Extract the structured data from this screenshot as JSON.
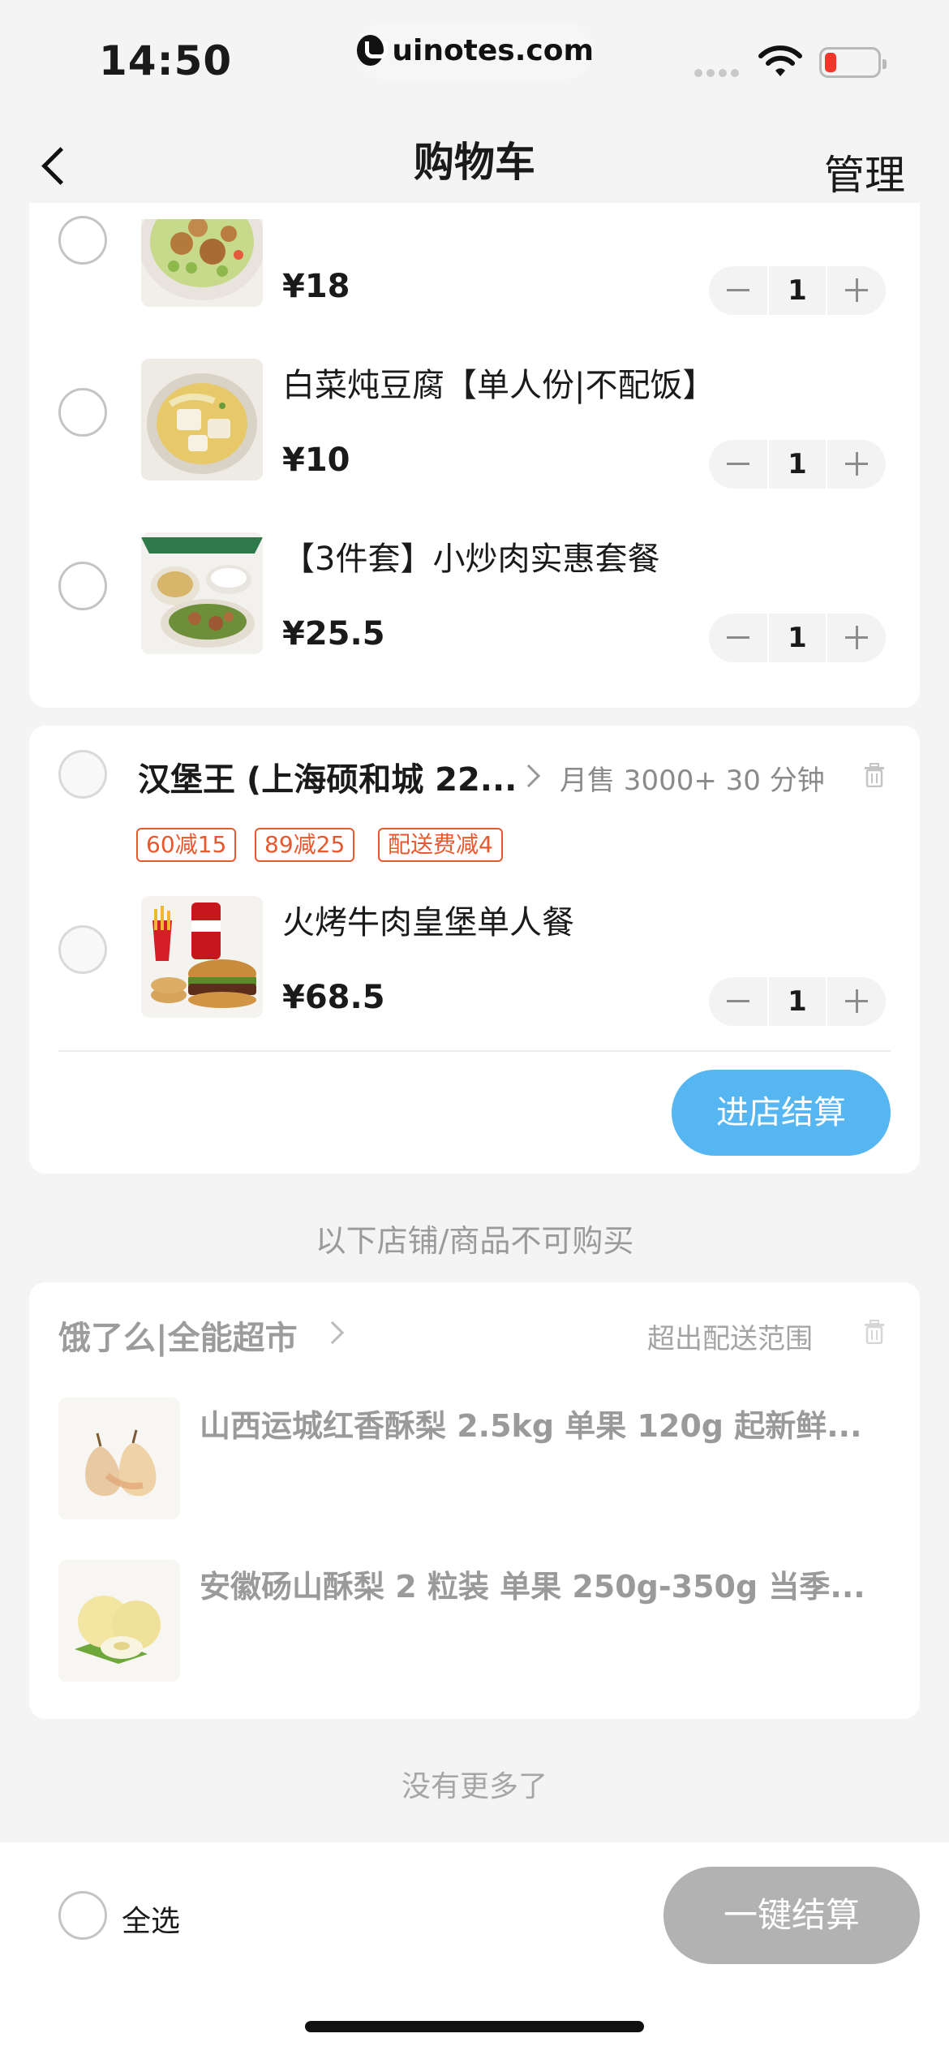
{
  "status_bar": {
    "time": "14:50",
    "url": "uinotes.com"
  },
  "nav": {
    "title": "购物车",
    "manage_label": "管理"
  },
  "store1": {
    "items": [
      {
        "price": "¥18",
        "qty": "1"
      },
      {
        "name": "白菜炖豆腐【单人份|不配饭】",
        "price": "¥10",
        "qty": "1"
      },
      {
        "name": "【3件套】小炒肉实惠套餐",
        "price": "¥25.5",
        "qty": "1"
      }
    ]
  },
  "store2": {
    "name": "汉堡王 (上海硕和城 22...",
    "meta": "月售 3000+ 30 分钟",
    "tags": [
      "60减15",
      "89减25",
      "配送费减4"
    ],
    "item": {
      "name": "火烤牛肉皇堡单人餐",
      "price": "¥68.5",
      "qty": "1"
    },
    "checkout_label": "进店结算"
  },
  "unavailable_hint": "以下店铺/商品不可购买",
  "store3": {
    "name": "饿了么|全能超市",
    "status": "超出配送范围",
    "items": [
      {
        "name": "山西运城红香酥梨 2.5kg 单果 120g 起新鲜..."
      },
      {
        "name": "安徽砀山酥梨 2 粒装 单果 250g-350g 当季..."
      }
    ]
  },
  "no_more": "没有更多了",
  "bottom": {
    "select_all_label": "全选",
    "checkout_label": "一键结算"
  },
  "colors": {
    "accent_blue": "#56b6f1",
    "tag_red": "#e8582f",
    "disabled_gray": "#b2b2b2"
  }
}
